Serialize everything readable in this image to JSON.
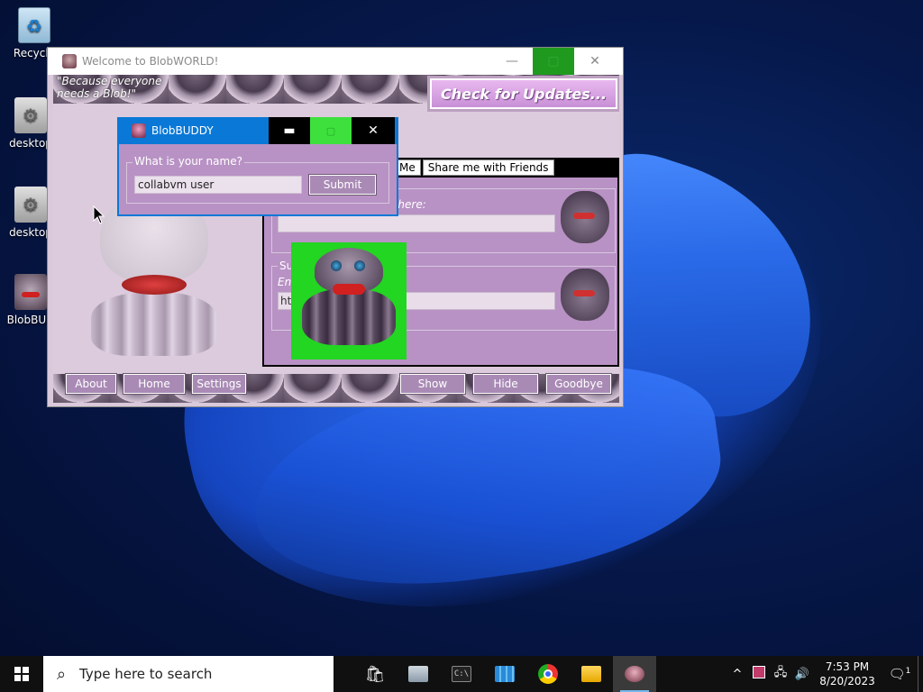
{
  "desktop": {
    "icons": [
      {
        "label": "Recycle",
        "icon": "recycle-bin-icon"
      },
      {
        "label": "desktop",
        "icon": "settings-file-icon"
      },
      {
        "label": "desktop",
        "icon": "settings-file-icon"
      },
      {
        "label": "BlobBUD",
        "icon": "blob-shortcut-icon"
      }
    ]
  },
  "main_window": {
    "title": "Welcome to BlobWORLD!",
    "slogan_line1": "\"Because everyone",
    "slogan_line2": "needs a Blob!\"",
    "updates_button": "Check for Updates...",
    "tabs": [
      "Me",
      "Share me with Friends"
    ],
    "group1": {
      "hint": "d here:"
    },
    "group2": {
      "legend": "Su",
      "hint": "En",
      "input_value": "htt"
    },
    "buttons": {
      "about": "About",
      "home": "Home",
      "settings": "Settings",
      "show": "Show",
      "hide": "Hide",
      "goodbye": "Goodbye"
    }
  },
  "dialog": {
    "title": "BlobBUDDY",
    "group_label": "What is your name?",
    "name_value": "collabvm user",
    "submit_label": "Submit",
    "accent": "#0a78d6",
    "maximize_color": "#3ee03e"
  },
  "taskbar": {
    "search_placeholder": "Type here to search",
    "time": "7:53 PM",
    "date": "8/20/2023",
    "notification_count": "1"
  },
  "colors": {
    "window_bg": "#dccbdc",
    "panel_purple": "#b892c4",
    "button_purple": "#a98ab5",
    "green": "#22d622"
  }
}
